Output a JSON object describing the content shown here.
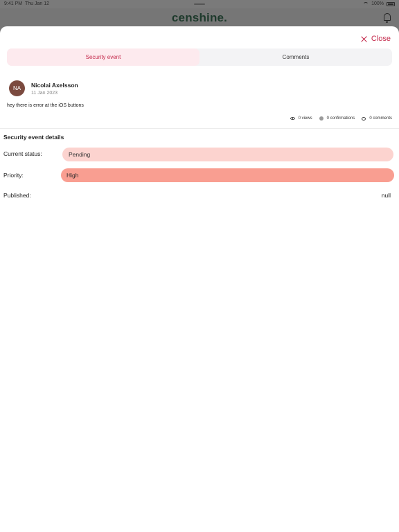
{
  "status_bar": {
    "time": "9:41 PM",
    "date": "Thu Jan 12",
    "battery": "100%"
  },
  "app_header": {
    "logo": "censhine."
  },
  "sheet": {
    "close_label": "Close",
    "tabs": [
      {
        "label": "Security event",
        "active": true
      },
      {
        "label": "Comments",
        "active": false
      }
    ],
    "post": {
      "avatar_initials": "NA",
      "author_name": "Nicolai Axelsson",
      "date": "11 Jan 2023",
      "message": "hey there is error at the iOS buttons",
      "views": "0 views",
      "confirmations": "0 confirmations",
      "comments": "0 comments"
    },
    "details": {
      "title": "Security event details",
      "status_label": "Current status:",
      "status_value": "Pending",
      "priority_label": "Priority:",
      "priority_value": "High",
      "published_label": "Published:",
      "published_value": "null"
    }
  },
  "colors": {
    "accent": "#c4294b",
    "active_tab_bg": "#fdeaee",
    "status_pill": "#fcd3cf",
    "priority_pill": "#f99e91",
    "avatar_bg": "#7b4a3f"
  },
  "icons": [
    "wifi-icon",
    "battery-icon",
    "bell-icon",
    "close-icon",
    "eye-icon",
    "confirmation-icon",
    "comment-icon"
  ]
}
